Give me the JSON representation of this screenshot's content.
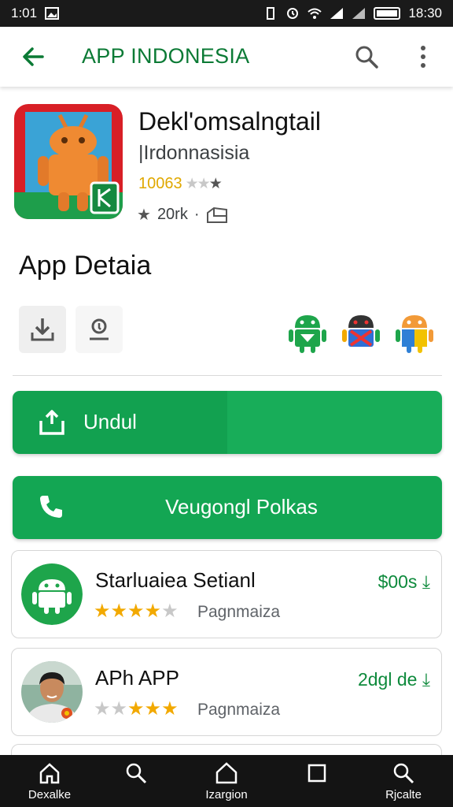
{
  "status_bar": {
    "time_left": "1:01",
    "time_right": "18:30",
    "battery_icon": "battery-icon"
  },
  "app_bar": {
    "title": "APP INDONESIA",
    "back_icon": "arrow-back-icon",
    "search_icon": "search-icon",
    "more_icon": "more-vert-icon"
  },
  "app": {
    "name": "Dekl'omsalngtail",
    "developer": "|Irdonnasisia",
    "rating_text": "10063",
    "downloads": "20rk",
    "icon": "android-robot-app-icon"
  },
  "section": {
    "title": "App Detaia"
  },
  "buttons": {
    "download_label": "Undul",
    "call_label": "Veugongl Polkas"
  },
  "list": [
    {
      "name": "Starluaiea Setianl",
      "price": "$00s",
      "subtitle": "Pagnmaiza",
      "rating": 4,
      "avatar": "android-robot-avatar"
    },
    {
      "name": "APh APP",
      "price": "2dgl de",
      "subtitle": "Pagnmaiza",
      "rating": 3.5,
      "avatar": "person-photo-avatar"
    }
  ],
  "bottom_nav": [
    {
      "label": "Dexalke",
      "icon": "home-icon"
    },
    {
      "label": "",
      "icon": "search-icon"
    },
    {
      "label": "Izargion",
      "icon": "home-outline-icon"
    },
    {
      "label": "",
      "icon": "square-icon"
    },
    {
      "label": "Rjcalte",
      "icon": "search-icon"
    }
  ],
  "colors": {
    "accent": "#13a653",
    "title_green": "#0b7a35",
    "star_gold": "#f2a900"
  }
}
